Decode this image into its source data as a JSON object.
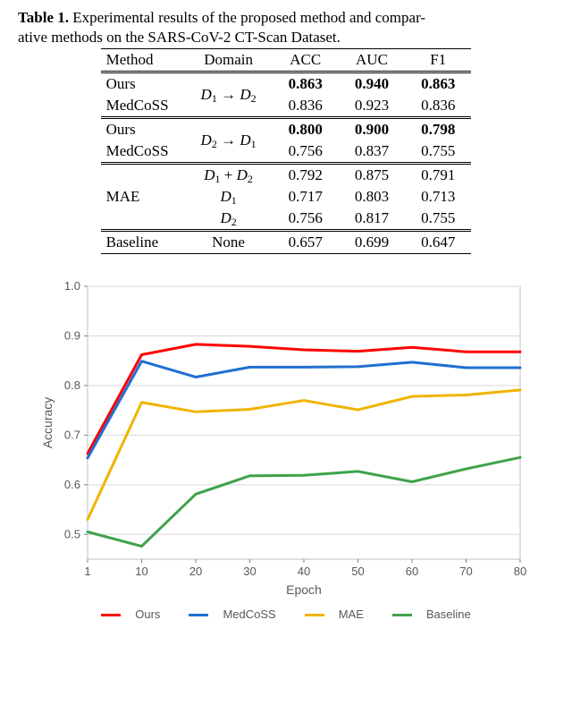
{
  "caption": {
    "label": "Table 1.",
    "text_a": " Experimental results of the proposed method and compar-",
    "text_b": "ative methods on the SARS-CoV-2 CT-Scan Dataset."
  },
  "table": {
    "headers": [
      "Method",
      "Domain",
      "ACC",
      "AUC",
      "F1"
    ],
    "groups": [
      {
        "domain_html": "D₁ → D₂",
        "rows": [
          {
            "method": "Ours",
            "acc": "0.863",
            "auc": "0.940",
            "f1": "0.863",
            "bold": true
          },
          {
            "method": "MedCoSS",
            "acc": "0.836",
            "auc": "0.923",
            "f1": "0.836",
            "bold": false
          }
        ]
      },
      {
        "domain_html": "D₂ → D₁",
        "rows": [
          {
            "method": "Ours",
            "acc": "0.800",
            "auc": "0.900",
            "f1": "0.798",
            "bold": true
          },
          {
            "method": "MedCoSS",
            "acc": "0.756",
            "auc": "0.837",
            "f1": "0.755",
            "bold": false
          }
        ]
      },
      {
        "method_span": "MAE",
        "rows": [
          {
            "domain": "D₁ + D₂",
            "acc": "0.792",
            "auc": "0.875",
            "f1": "0.791"
          },
          {
            "domain": "D₁",
            "acc": "0.717",
            "auc": "0.803",
            "f1": "0.713"
          },
          {
            "domain": "D₂",
            "acc": "0.756",
            "auc": "0.817",
            "f1": "0.755"
          }
        ]
      },
      {
        "rows": [
          {
            "method": "Baseline",
            "domain": "None",
            "acc": "0.657",
            "auc": "0.699",
            "f1": "0.647"
          }
        ]
      }
    ]
  },
  "chart_data": {
    "type": "line",
    "title": "",
    "xlabel": "Epoch",
    "ylabel": "Accuracy",
    "xlim": [
      1,
      80
    ],
    "ylim": [
      0.45,
      1.0
    ],
    "x": [
      1,
      10,
      20,
      30,
      40,
      50,
      60,
      70,
      80
    ],
    "yticks": [
      0.5,
      0.6,
      0.7,
      0.8,
      0.9,
      1.0
    ],
    "series": [
      {
        "name": "Ours",
        "color": "#ff0000",
        "values": [
          0.663,
          0.862,
          0.883,
          0.879,
          0.872,
          0.869,
          0.877,
          0.868,
          0.868
        ]
      },
      {
        "name": "MedCoSS",
        "color": "#1f6fd1",
        "values": [
          0.654,
          0.849,
          0.817,
          0.837,
          0.837,
          0.838,
          0.847,
          0.836,
          0.836
        ]
      },
      {
        "name": "MAE",
        "color": "#f0b400",
        "values": [
          0.53,
          0.766,
          0.747,
          0.752,
          0.77,
          0.751,
          0.778,
          0.781,
          0.791
        ]
      },
      {
        "name": "Baseline",
        "color": "#3fa24a",
        "values": [
          0.505,
          0.476,
          0.581,
          0.618,
          0.619,
          0.627,
          0.606,
          0.632,
          0.655
        ]
      }
    ],
    "legend_position": "bottom"
  }
}
